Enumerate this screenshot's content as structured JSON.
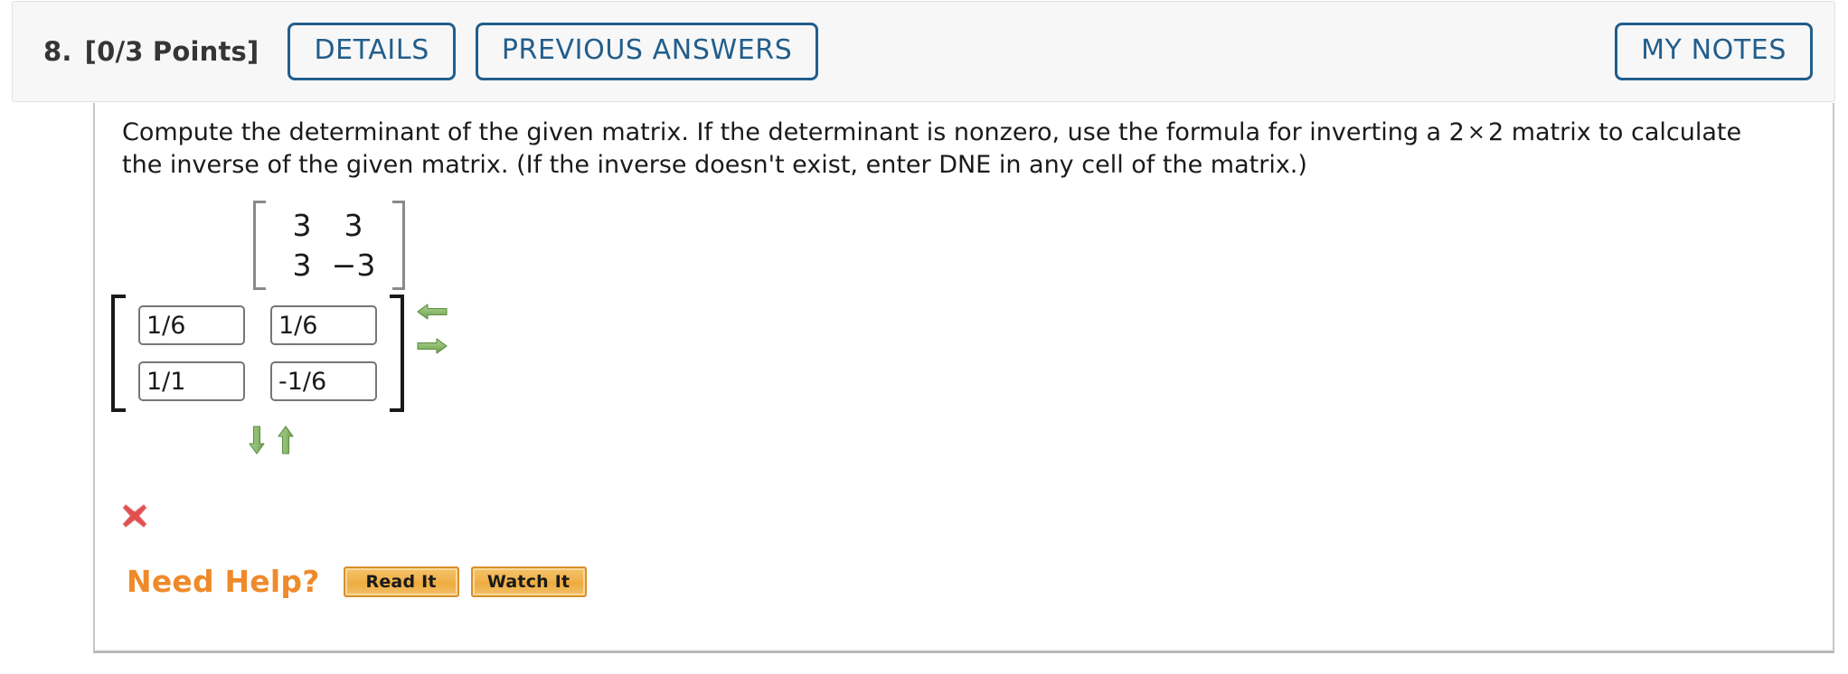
{
  "header": {
    "question_number": "8.",
    "points": "[0/3 Points]",
    "details_label": "DETAILS",
    "previous_answers_label": "PREVIOUS ANSWERS",
    "my_notes_label": "MY NOTES",
    "accent_color": "#215e8c",
    "background_color": "#f7f7f7"
  },
  "problem": {
    "line1": "Compute the determinant of the given matrix. If the determinant is nonzero, use the formula for inverting a 2",
    "times_symbol": "×",
    "line1_end": "2 matrix to calculate the",
    "line2": "inverse of the given matrix. (If the inverse doesn't exist, enter DNE in any cell of the matrix.)"
  },
  "given_matrix": {
    "rows": [
      [
        "3",
        "3"
      ],
      [
        "3",
        "−3"
      ]
    ]
  },
  "answer_matrix": {
    "cells": [
      {
        "name": "cell-r1c1",
        "value": "1/6"
      },
      {
        "name": "cell-r1c2",
        "value": "1/6"
      },
      {
        "name": "cell-r2c1",
        "value": "1/1"
      },
      {
        "name": "cell-r2c2",
        "value": "-1/6"
      }
    ]
  },
  "matrix_controls": {
    "left_arrow": "arrow-left-icon",
    "right_arrow": "arrow-right-icon",
    "down_arrow": "arrow-down-icon",
    "up_arrow": "arrow-up-icon",
    "arrow_color": "#7eb05f"
  },
  "feedback": {
    "status": "incorrect",
    "icon": "x-mark-icon",
    "color": "#e05252"
  },
  "need_help": {
    "label": "Need Help?",
    "label_color": "#ef8a2b",
    "buttons": [
      {
        "name": "read-it-button",
        "label": "Read It"
      },
      {
        "name": "watch-it-button",
        "label": "Watch It"
      }
    ]
  }
}
